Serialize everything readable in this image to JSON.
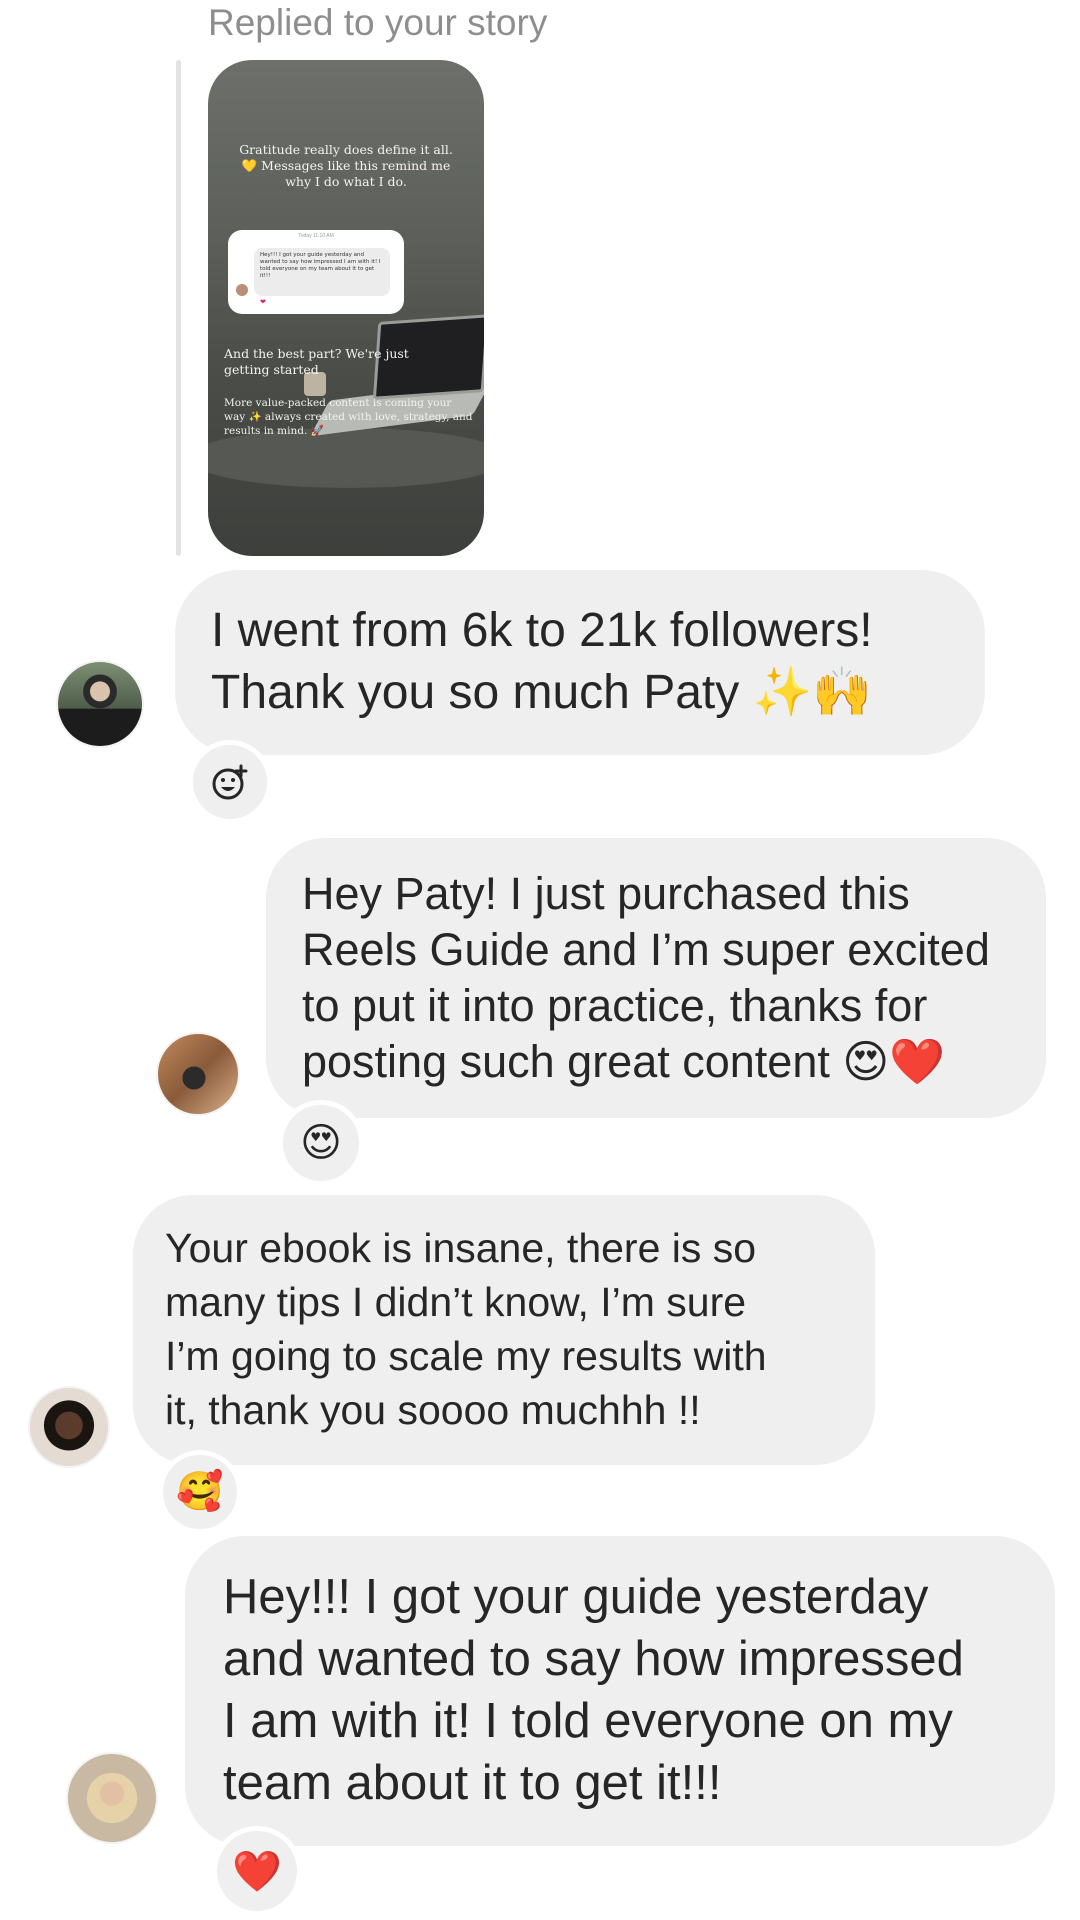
{
  "story_reply": {
    "label": "Replied to your story",
    "story": {
      "top_text": "Gratitude really does define it all. 💛 Messages like this remind me why I do what I do.",
      "mini_dm_time": "Today 11:10 AM",
      "mini_dm_text": "Hey!!! I got your guide yesterday and wanted to say how impressed I am with it! I told everyone on my team about it to get it!!!",
      "mid_text": "And the best part? We're just getting started",
      "bottom_text": "More value-packed content is coming your way ✨ always created with love, strategy, and results in mind. 🚀"
    }
  },
  "messages": [
    {
      "text": "I went from 6k to 21k followers!\nThank you so much Paty ✨🙌",
      "reaction": "add-reaction",
      "avatar_colors": [
        "#5b6b54",
        "#1a1a1a"
      ]
    },
    {
      "text": "Hey Paty! I just purchased this\nReels Guide and I’m super excited\nto put it into practice, thanks for\nposting such great content 😍❤️",
      "reaction": "😍",
      "avatar_colors": [
        "#a4704a",
        "#2b2b2b"
      ]
    },
    {
      "text": "Your ebook is insane, there is so\nmany tips I didn’t know, I’m sure\nI’m going to scale my results with\nit, thank you soooo muchhh !!",
      "reaction": "🥰",
      "avatar_colors": [
        "#3b2a22",
        "#e8dcd0"
      ]
    },
    {
      "text": "Hey!!! I got your guide yesterday\nand wanted to say how impressed\nI am with it! I told everyone on my\nteam about it to get it!!!",
      "reaction": "❤️",
      "avatar_colors": [
        "#d8c7ae",
        "#c79a7a"
      ]
    }
  ],
  "colors": {
    "bubble_bg": "#efefef",
    "label_gray": "#8e8e8e",
    "text": "#262626"
  }
}
